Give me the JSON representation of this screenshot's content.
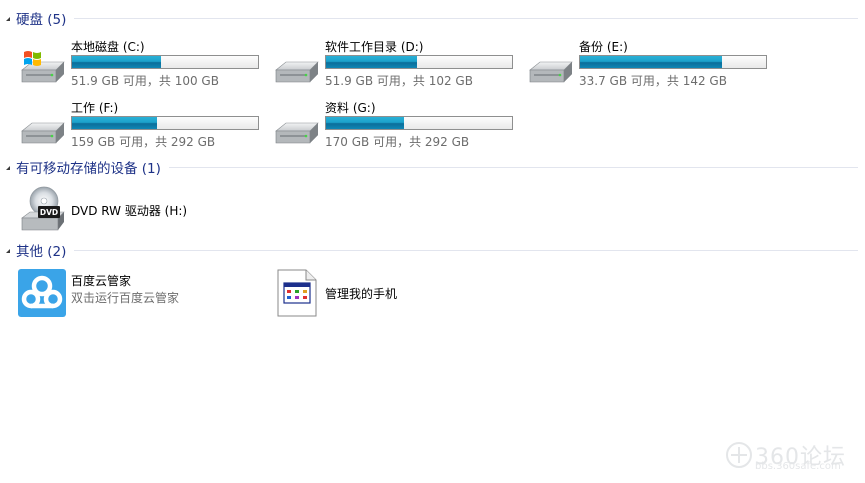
{
  "groups": {
    "hard_disks": {
      "title": "硬盘 (5)"
    },
    "removable": {
      "title": "有可移动存储的设备 (1)"
    },
    "other": {
      "title": "其他 (2)"
    }
  },
  "drives": [
    {
      "name": "本地磁盘 (C:)",
      "free_text": "51.9 GB 可用，共 100 GB",
      "used_fraction": 0.481,
      "windows_logo": true
    },
    {
      "name": "软件工作目录 (D:)",
      "free_text": "51.9 GB 可用，共 102 GB",
      "used_fraction": 0.491
    },
    {
      "name": "备份 (E:)",
      "free_text": "33.7 GB 可用，共 142 GB",
      "used_fraction": 0.763
    },
    {
      "name": "工作 (F:)",
      "free_text": "159 GB 可用，共 292 GB",
      "used_fraction": 0.455
    },
    {
      "name": "资料 (G:)",
      "free_text": "170 GB 可用，共 292 GB",
      "used_fraction": 0.418
    }
  ],
  "removable": {
    "name": "DVD RW 驱动器 (H:)",
    "icon_label": "DVD"
  },
  "other_items": [
    {
      "name": "百度云管家",
      "desc": "双击运行百度云管家",
      "icon": "baidu-cloud-icon"
    },
    {
      "name": "管理我的手机",
      "desc": "",
      "icon": "phone-manager-icon"
    }
  ],
  "watermark": {
    "brand": "360论坛",
    "url": "bbs.360safe.com"
  },
  "colors": {
    "group_title": "#1e3287",
    "bar_fill": "#1ca2cb",
    "free_text": "#6d6d6d"
  }
}
